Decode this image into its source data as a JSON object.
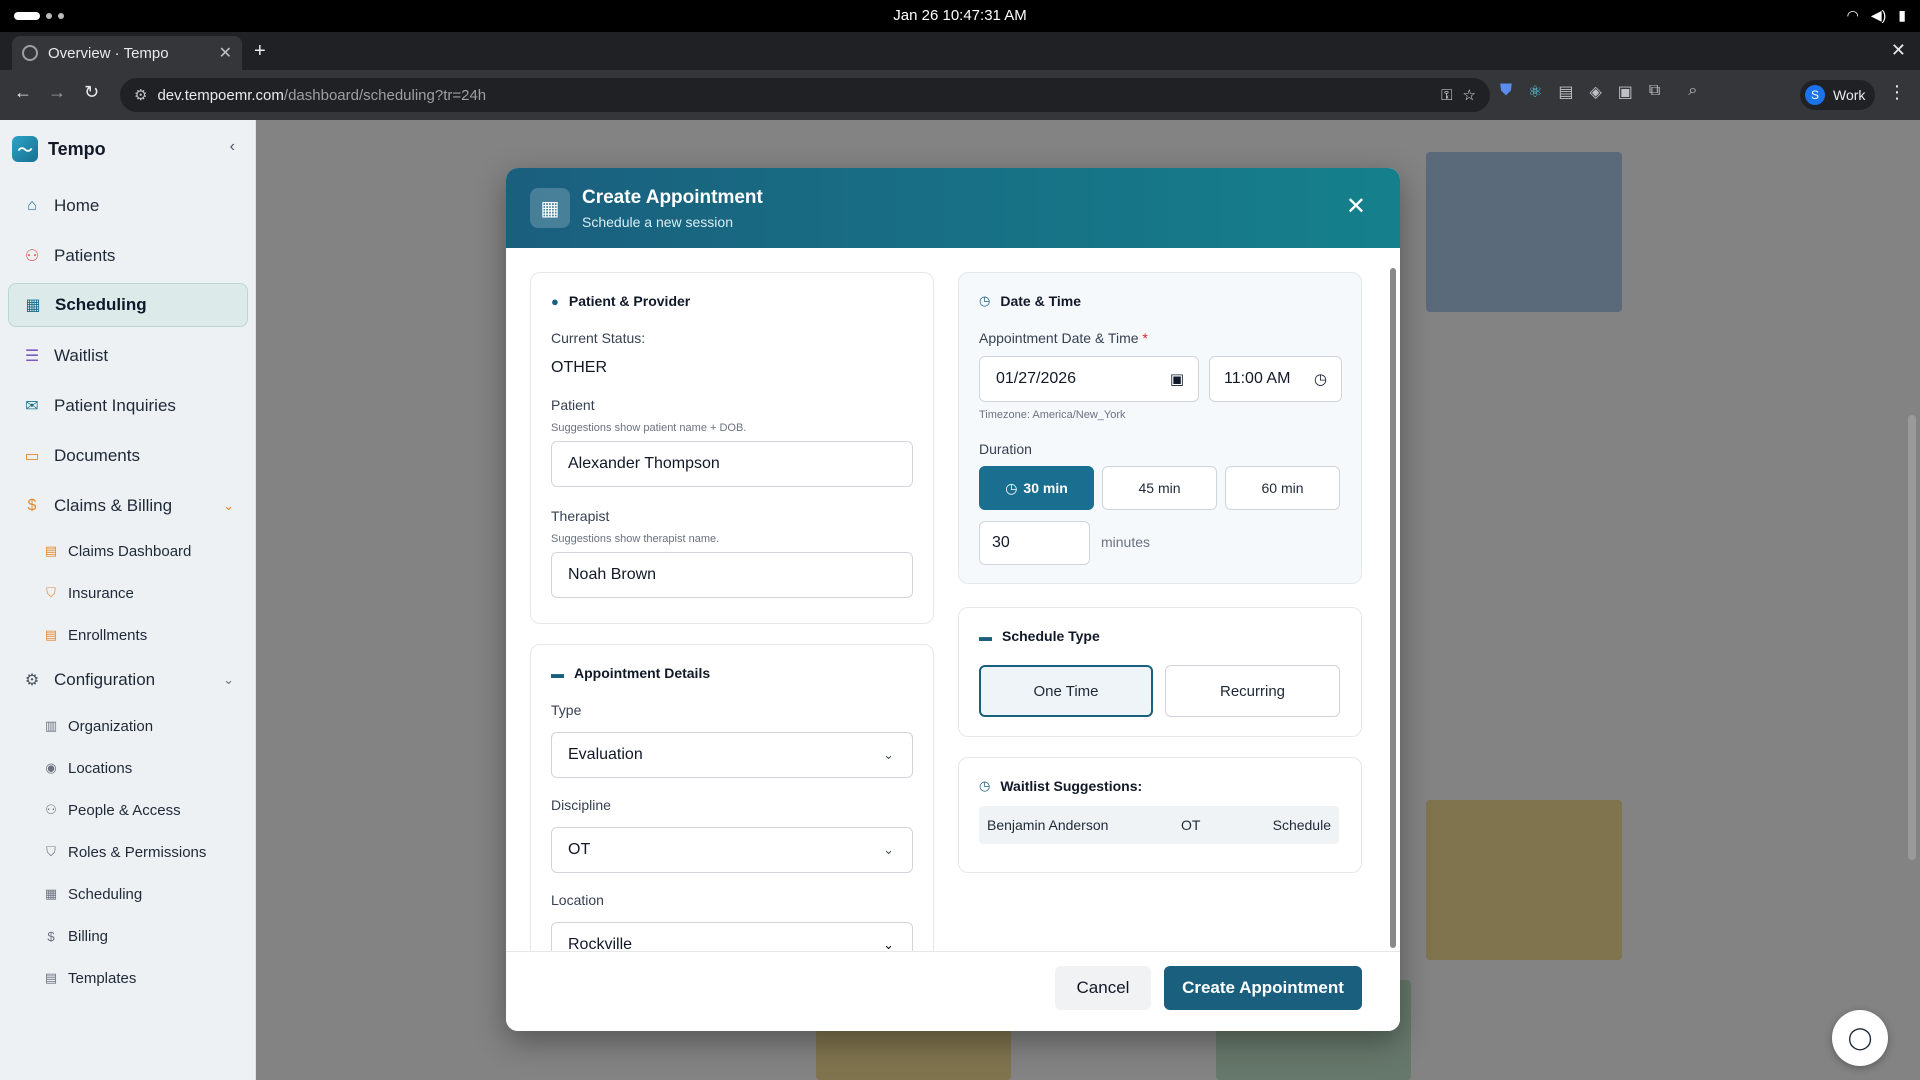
{
  "os": {
    "clock": "Jan 26  10:47:31 AM"
  },
  "browser": {
    "tab_title": "Overview · Tempo",
    "url_host": "dev.tempoemr.com",
    "url_path": "/dashboard/scheduling?tr=24h",
    "profile_initial": "S",
    "profile_label": "Work"
  },
  "sidebar": {
    "brand": "Tempo",
    "items": [
      {
        "label": "Home",
        "icon": "home-icon"
      },
      {
        "label": "Patients",
        "icon": "users-icon"
      },
      {
        "label": "Scheduling",
        "icon": "calendar-icon",
        "active": true
      },
      {
        "label": "Waitlist",
        "icon": "list-icon"
      },
      {
        "label": "Patient Inquiries",
        "icon": "mail-icon"
      },
      {
        "label": "Documents",
        "icon": "folder-icon"
      },
      {
        "label": "Claims & Billing",
        "icon": "billing-icon"
      },
      {
        "label": "Configuration",
        "icon": "gear-icon"
      }
    ],
    "billing_sub": [
      "Claims Dashboard",
      "Insurance",
      "Enrollments"
    ],
    "config_sub": [
      "Organization",
      "Locations",
      "People & Access",
      "Roles & Permissions",
      "Scheduling",
      "Billing",
      "Templates"
    ]
  },
  "modal": {
    "title": "Create Appointment",
    "subtitle": "Schedule a new session",
    "patient_provider": {
      "heading": "Patient & Provider",
      "status_label": "Current Status:",
      "status_value": "OTHER",
      "patient_label": "Patient",
      "patient_hint": "Suggestions show patient name + DOB.",
      "patient_value": "Alexander Thompson",
      "therapist_label": "Therapist",
      "therapist_hint": "Suggestions show therapist name.",
      "therapist_value": "Noah Brown"
    },
    "details": {
      "heading": "Appointment Details",
      "type_label": "Type",
      "type_value": "Evaluation",
      "discipline_label": "Discipline",
      "discipline_value": "OT",
      "location_label": "Location",
      "location_value": "Rockville"
    },
    "datetime": {
      "heading": "Date & Time",
      "label": "Appointment Date & Time",
      "required_mark": "*",
      "date_value": "01/27/2026",
      "time_value": "11:00 AM",
      "timezone": "Timezone: America/New_York",
      "duration_label": "Duration",
      "duration_options": [
        "30 min",
        "45 min",
        "60 min"
      ],
      "duration_selected": "30 min",
      "minutes_value": "30",
      "minutes_unit": "minutes"
    },
    "schedule_type": {
      "heading": "Schedule Type",
      "options": [
        "One Time",
        "Recurring"
      ],
      "selected": "One Time"
    },
    "waitlist": {
      "heading": "Waitlist Suggestions:",
      "rows": [
        {
          "name": "Benjamin Anderson",
          "discipline": "OT",
          "action": "Schedule"
        }
      ]
    },
    "cancel_label": "Cancel",
    "submit_label": "Create Appointment"
  },
  "colors": {
    "brand": "#1a5f7e",
    "active_nav": "#dcebea"
  }
}
